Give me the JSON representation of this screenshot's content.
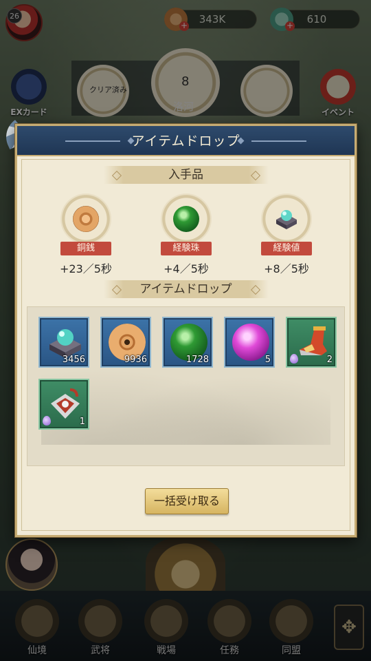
{
  "topbar": {
    "level": "26",
    "copper": "343K",
    "jade": "610"
  },
  "side": {
    "ex_card": "EXカード",
    "event": "イベント"
  },
  "stage": {
    "cleared_label": "クリア済み",
    "number": "8",
    "name": "洛河"
  },
  "modal": {
    "title": "アイテムドロップ",
    "obtain_section": "入手品",
    "obtain": [
      {
        "label": "銅銭",
        "rate": "+23／5秒",
        "icon": "copper-coin-icon"
      },
      {
        "label": "経験珠",
        "rate": "+4／5秒",
        "icon": "green-pearl-icon"
      },
      {
        "label": "経験値",
        "rate": "+8／5秒",
        "icon": "jade-chest-icon"
      }
    ],
    "drop_section": "アイテムドロップ",
    "drops": [
      {
        "icon": "jade-chest-icon",
        "qty": "3456",
        "rarity": "blue"
      },
      {
        "icon": "copper-coin-icon",
        "qty": "9936",
        "rarity": "blue"
      },
      {
        "icon": "green-pearl-icon",
        "qty": "1728",
        "rarity": "blue"
      },
      {
        "icon": "purple-pearl-icon",
        "qty": "5",
        "rarity": "blue"
      },
      {
        "icon": "boot-icon",
        "qty": "2",
        "rarity": "green"
      },
      {
        "icon": "armor-piece-icon",
        "qty": "1",
        "rarity": "green"
      }
    ],
    "claim_button": "一括受け取る"
  },
  "nav": {
    "items": [
      "仙境",
      "武将",
      "戦場",
      "任務",
      "同盟"
    ]
  }
}
